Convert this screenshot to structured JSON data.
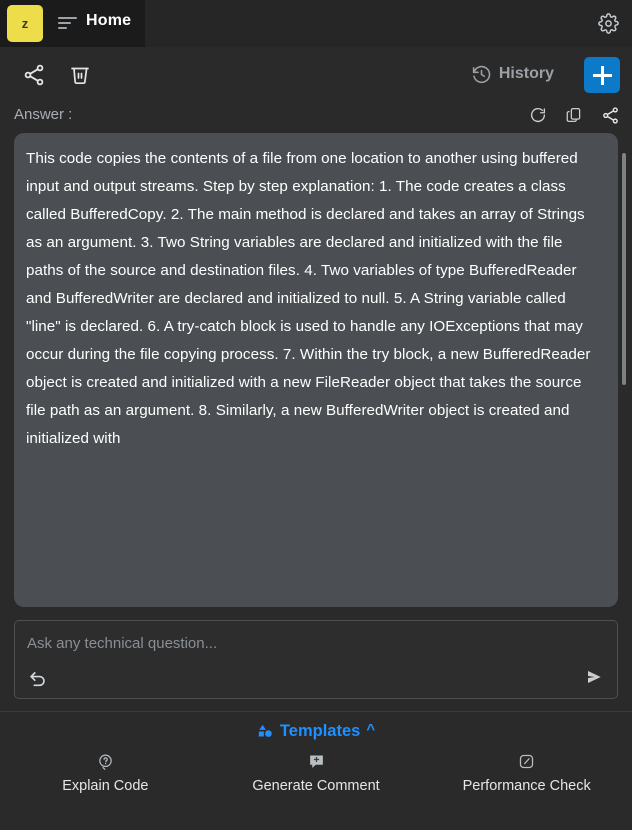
{
  "titlebar": {
    "logo_text": "z",
    "menu_icon": "hamburger-icon",
    "tab_label": "Home",
    "settings_icon": "gear-icon"
  },
  "actionbar": {
    "share_icon": "share-icon",
    "trash_icon": "trash-icon",
    "history_label": "History",
    "history_icon": "clock-rewind-icon",
    "new_icon": "plus-icon"
  },
  "answer": {
    "label": "Answer :",
    "refresh_icon": "refresh-icon",
    "copy_icon": "copy-icon",
    "share_icon": "share-icon",
    "body": "This code copies the contents of a file from one location to another using buffered input and output streams.\n Step by step explanation:\n1. The code creates a class called BufferedCopy.\n2. The main method is declared and takes an array of Strings as an argument.\n3. Two String variables are declared and initialized with the file paths of the source and destination files.\n4. Two variables of type BufferedReader and BufferedWriter are declared and initialized to null.\n5. A String variable called \"line\" is declared.\n6. A try-catch block is used to handle any IOExceptions that may occur during the file copying process.\n7. Within the try block, a new BufferedReader object is created and initialized with a new FileReader object that takes the source file path as an argument.\n8. Similarly, a new BufferedWriter object is created and initialized with",
    "lines": [
      "This code copies the contents of a file from one location to another using buffered input and output streams.",
      " Step by step explanation:",
      "1. The code creates a class called BufferedCopy.",
      "2. The main method is declared and takes an array of Strings as an argument.",
      "3. Two String variables are declared and initialized with the file paths of the source and destination files.",
      "4. Two variables of type BufferedReader and BufferedWriter are declared and initialized to null.",
      "5. A String variable called \"line\" is declared.",
      "6. A try-catch block is used to handle any IOExceptions that may occur during the file copying process.",
      "7. Within the try block, a new BufferedReader object is created and initialized with a new FileReader object that takes the source file path as an argument.",
      "8. Similarly, a new BufferedWriter object is created and initialized with"
    ]
  },
  "input": {
    "placeholder": "Ask any technical question...",
    "value": "",
    "undo_icon": "undo-arrow-icon",
    "send_icon": "send-arrow-icon"
  },
  "footer": {
    "templates_label": "Templates",
    "templates_icon": "shapes-icon",
    "templates_caret": "^",
    "shortcuts": [
      {
        "label": "Explain Code",
        "icon": "question-bubble-icon"
      },
      {
        "label": "Generate Comment",
        "icon": "comment-plus-icon"
      },
      {
        "label": "Performance Check",
        "icon": "gauge-icon"
      }
    ]
  },
  "colors": {
    "accent_blue": "#0d7ac9",
    "link_blue": "#1e90ff",
    "logo_yellow": "#eedd4a",
    "page_bg": "#2a2a2a",
    "answer_bg": "#4b4f53",
    "titlebar_bg": "#262626",
    "tab_bg": "#1b1b1b"
  }
}
